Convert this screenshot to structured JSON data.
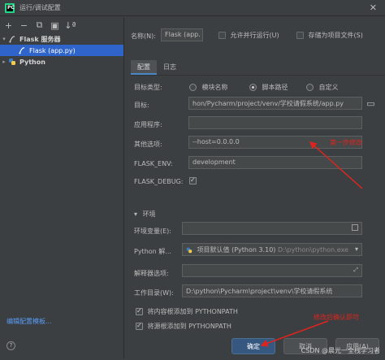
{
  "window": {
    "title": "运行/调试配置",
    "close_glyph": "✕"
  },
  "left": {
    "toolbar": {
      "add": "+",
      "remove": "−",
      "copy": "⧉",
      "folder": "▣",
      "sort": "↓ª"
    },
    "tree": {
      "flask_group": "Flask 服务器",
      "flask_item": "Flask (app.py)",
      "python_group": "Python"
    },
    "edit_templates": "编辑配置模板...",
    "help": "?"
  },
  "header": {
    "name_label": "名称(N):",
    "name_value": "Flask (app.",
    "allow_parallel": "允许并行运行(U)",
    "store_as_file": "存储为项目文件(S)"
  },
  "tabs": [
    {
      "label": "配置"
    },
    {
      "label": "日志"
    }
  ],
  "form": {
    "target_type_label": "目标类型:",
    "target_type_options": [
      "模块名称",
      "脚本路径",
      "自定义"
    ],
    "target_label": "目标:",
    "target_value": "hon/Pycharm/project/venv/学校请假系统/app.py",
    "app_label": "应用程序:",
    "app_value": "",
    "other_opts_label": "其他选项:",
    "other_opts_value": "--host=0.0.0.0",
    "flask_env_label": "FLASK_ENV:",
    "flask_env_value": "development",
    "flask_debug_label": "FLASK_DEBUG:",
    "env_section": "环境",
    "env_vars_label": "环境变量(E):",
    "interpreter_label": "Python 解...",
    "interpreter_value": "项目默认值 (Python 3.10)",
    "interpreter_path": "D:\\python\\python.exe",
    "interp_opts_label": "解释器选项:",
    "workdir_label": "工作目录(W):",
    "workdir_value": "D:\\python\\Pycharm\\project\\venv\\学校请假系统",
    "add_content_roots": "将内容根添加到 PYTHONPATH",
    "add_source_roots": "将源根添加到 PYTHONPATH"
  },
  "buttons": {
    "ok": "确定",
    "cancel": "取消",
    "apply": "应用(A)"
  },
  "annotations": {
    "step1": "第一步修改",
    "confirm": "修改后确认即可",
    "watermark": "CSDN @晨光一全栈学习者"
  },
  "colors": {
    "accent": "#2f65ca",
    "annotation": "#e0241d",
    "ok_button": "#365880"
  }
}
